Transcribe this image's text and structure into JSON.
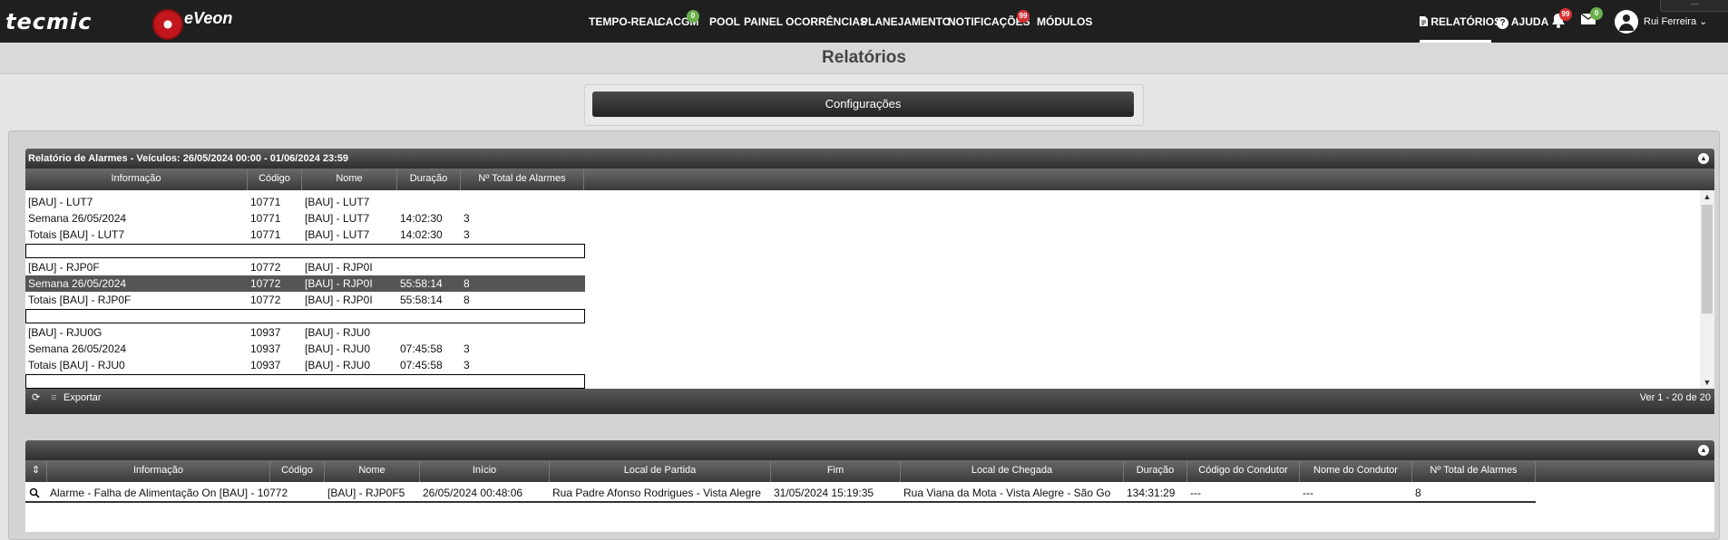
{
  "nav": {
    "brand": "tecmic",
    "product": "eVeon",
    "items": [
      "TEMPO-REAL",
      "CACGM",
      "POOL",
      "PAINEL",
      "OCORRÊNCIAS",
      "PLANEJAMENTO",
      "NOTIFICAÇÕES",
      "MÓDULOS"
    ],
    "cacgm_badge": "0",
    "notificacoes_badge": "99",
    "relatorios": "RELATÓRIOS",
    "ajuda": "AJUDA",
    "bell_badge": "99",
    "mail_badge": "0",
    "user": "Rui Ferreira"
  },
  "page": {
    "title": "Relatórios",
    "config_button": "Configurações"
  },
  "report": {
    "title": "Relatório de Alarmes - Veículos: 26/05/2024 00:00 - 01/06/2024 23:59",
    "columns": [
      "Informação",
      "Código",
      "Nome",
      "Duração",
      "Nº Total de Alarmes"
    ],
    "groups": [
      {
        "rows": [
          [
            "[BAU] - LUT7",
            "10771",
            "[BAU] - LUT7",
            "",
            ""
          ],
          [
            "Semana 26/05/2024",
            "10771",
            "[BAU] - LUT7",
            "14:02:30",
            "3"
          ],
          [
            "Totais [BAU] - LUT7",
            "10771",
            "[BAU] - LUT7",
            "14:02:30",
            "3"
          ]
        ]
      },
      {
        "rows": [
          [
            "[BAU] - RJP0F",
            "10772",
            "[BAU] - RJP0I",
            "",
            ""
          ],
          [
            "Semana 26/05/2024",
            "10772",
            "[BAU] - RJP0I",
            "55:58:14",
            "8"
          ],
          [
            "Totais [BAU] - RJP0F",
            "10772",
            "[BAU] - RJP0I",
            "55:58:14",
            "8"
          ]
        ]
      },
      {
        "rows": [
          [
            "[BAU] - RJU0G",
            "10937",
            "[BAU] - RJU0",
            "",
            ""
          ],
          [
            "Semana 26/05/2024",
            "10937",
            "[BAU] - RJU0",
            "07:45:58",
            "3"
          ],
          [
            "Totais [BAU] - RJU0",
            "10937",
            "[BAU] - RJU0",
            "07:45:58",
            "3"
          ]
        ]
      }
    ],
    "export_label": "Exportar",
    "pager": "Ver 1 - 20 de 20"
  },
  "detail": {
    "columns": [
      "Informação",
      "Código",
      "Nome",
      "Início",
      "Local de Partida",
      "Fim",
      "Local de Chegada",
      "Duração",
      "Código do Condutor",
      "Nome do Condutor",
      "Nº Total de Alarmes"
    ],
    "row": [
      "Alarme - Falha de Alimentação On [BAU] - 10772",
      "",
      "[BAU] - RJP0F5",
      "26/05/2024 00:48:06",
      "Rua Padre Afonso Rodrigues - Vista Alegre",
      "31/05/2024 15:19:35",
      "Rua Viana da Mota - Vista Alegre - São Go",
      "134:31:29",
      "---",
      "---",
      "8"
    ]
  }
}
